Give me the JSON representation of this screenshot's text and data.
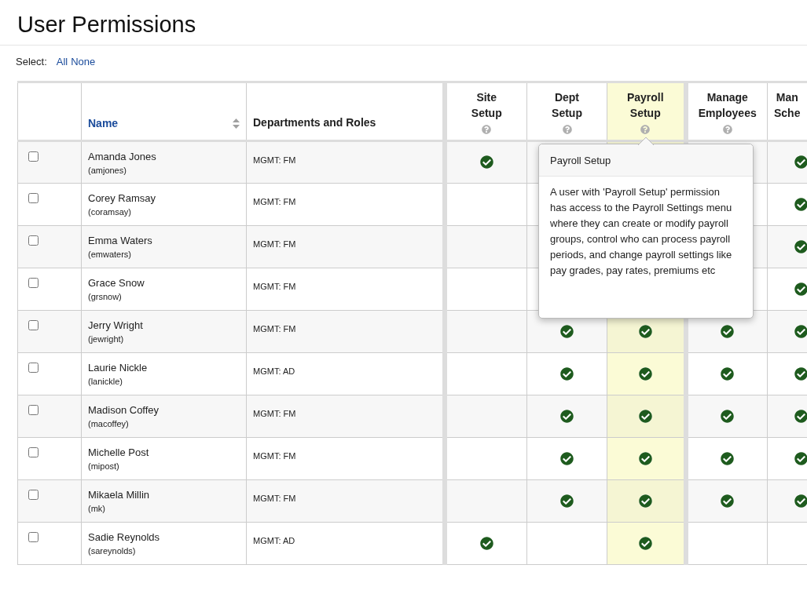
{
  "title": "User Permissions",
  "select": {
    "label": "Select:",
    "links": [
      "All",
      "None"
    ]
  },
  "table": {
    "columns": {
      "name": "Name",
      "departments": "Departments and Roles",
      "permissions": [
        {
          "lines": [
            "Site",
            "Setup"
          ],
          "highlighted": false,
          "group_start": true
        },
        {
          "lines": [
            "Dept",
            "Setup"
          ],
          "highlighted": false,
          "group_start": false
        },
        {
          "lines": [
            "Payroll",
            "Setup"
          ],
          "highlighted": true,
          "group_start": false
        },
        {
          "lines": [
            "Manage",
            "Employees"
          ],
          "highlighted": false,
          "group_start": true
        },
        {
          "lines": [
            "Man",
            "Sche"
          ],
          "highlighted": false,
          "group_start": false
        }
      ]
    },
    "rows": [
      {
        "name": "Amanda Jones",
        "username": "(amjones)",
        "role": "MGMT: FM",
        "checked": false,
        "permissions": {
          "site_setup": true,
          "column_5": true
        }
      },
      {
        "name": "Corey Ramsay",
        "username": "(coramsay)",
        "role": "MGMT: FM",
        "checked": false,
        "permissions": {
          "site_setup": false,
          "column_5": true
        }
      },
      {
        "name": "Emma Waters",
        "username": "(emwaters)",
        "role": "MGMT: FM",
        "checked": false,
        "permissions": {
          "site_setup": false,
          "column_5": true
        }
      },
      {
        "name": "Grace Snow",
        "username": "(grsnow)",
        "role": "MGMT: FM",
        "checked": false,
        "permissions": {
          "site_setup": false,
          "column_5": true
        }
      },
      {
        "name": "Jerry Wright",
        "username": "(jewright)",
        "role": "MGMT: FM",
        "checked": false,
        "permissions": {
          "site_setup": false,
          "dept_setup": true,
          "payroll_setup": true,
          "manage_employees": true,
          "column_5": true
        }
      },
      {
        "name": "Laurie Nickle",
        "username": "(lanickle)",
        "role": "MGMT: AD",
        "checked": false,
        "permissions": {
          "site_setup": false,
          "dept_setup": true,
          "payroll_setup": true,
          "manage_employees": true,
          "column_5": true
        }
      },
      {
        "name": "Madison Coffey",
        "username": "(macoffey)",
        "role": "MGMT: FM",
        "checked": false,
        "permissions": {
          "site_setup": false,
          "dept_setup": true,
          "payroll_setup": true,
          "manage_employees": true,
          "column_5": true
        }
      },
      {
        "name": "Michelle Post",
        "username": "(mipost)",
        "role": "MGMT: FM",
        "checked": false,
        "permissions": {
          "site_setup": false,
          "dept_setup": true,
          "payroll_setup": true,
          "manage_employees": true,
          "column_5": true
        }
      },
      {
        "name": "Mikaela Millin",
        "username": "(mk)",
        "role": "MGMT: FM",
        "checked": false,
        "permissions": {
          "site_setup": false,
          "dept_setup": true,
          "payroll_setup": true,
          "manage_employees": true,
          "column_5": true
        }
      },
      {
        "name": "Sadie Reynolds",
        "username": "(sareynolds)",
        "role": "MGMT: AD",
        "checked": false,
        "permissions": {
          "site_setup": true,
          "dept_setup": false,
          "payroll_setup": true,
          "manage_employees": false,
          "column_5": false
        }
      }
    ]
  },
  "tooltip": {
    "title": "Payroll Setup",
    "text": "A user with 'Payroll Setup' permission has access to the Payroll Settings menu where they can create or modify payroll groups, control who can process payroll periods, and change payroll settings like pay grades, pay rates, premiums etc"
  }
}
